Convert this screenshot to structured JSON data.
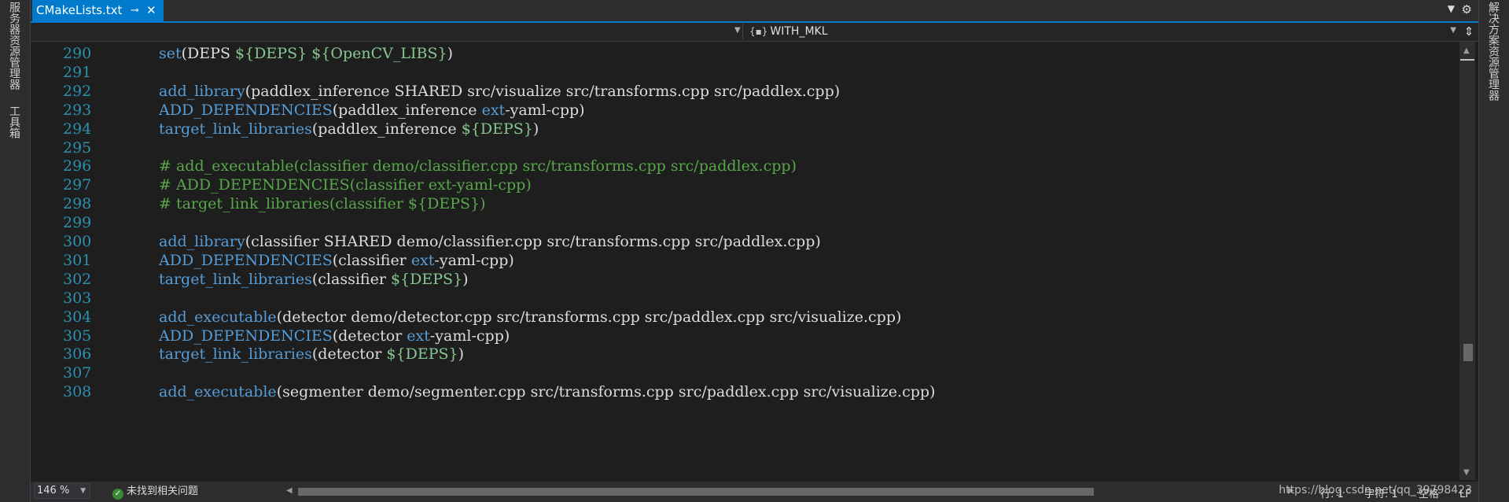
{
  "left_panel": {
    "tabs": [
      "服务器资源管理器",
      "工具箱"
    ]
  },
  "right_panel": {
    "tabs": [
      "解决方案资源管理器"
    ]
  },
  "document_tab": {
    "title": "CMakeLists.txt",
    "pin_icon": "pin-icon",
    "close_icon": "close-icon"
  },
  "navigation": {
    "scope": "WITH_MKL",
    "scope_icon": "macro-icon"
  },
  "code_lines": [
    {
      "n": "290",
      "segments": [
        [
          "fn",
          "set"
        ],
        [
          "p",
          "(DEPS "
        ],
        [
          "var",
          "${DEPS}"
        ],
        [
          "p",
          " "
        ],
        [
          "var",
          "${OpenCV_LIBS}"
        ],
        [
          "p",
          ")"
        ]
      ]
    },
    {
      "n": "291",
      "segments": []
    },
    {
      "n": "292",
      "segments": [
        [
          "fn",
          "add_library"
        ],
        [
          "p",
          "(paddlex_inference SHARED src/visualize src/transforms.cpp src/paddlex.cpp)"
        ]
      ]
    },
    {
      "n": "293",
      "segments": [
        [
          "fn",
          "ADD_DEPENDENCIES"
        ],
        [
          "p",
          "(paddlex_inference "
        ],
        [
          "kw",
          "ext"
        ],
        [
          "p",
          "-yaml-cpp)"
        ]
      ]
    },
    {
      "n": "294",
      "segments": [
        [
          "fn",
          "target_link_libraries"
        ],
        [
          "p",
          "(paddlex_inference "
        ],
        [
          "var",
          "${DEPS}"
        ],
        [
          "p",
          ")"
        ]
      ]
    },
    {
      "n": "295",
      "segments": []
    },
    {
      "n": "296",
      "segments": [
        [
          "cm",
          "# add_executable(classifier demo/classifier.cpp src/transforms.cpp src/paddlex.cpp)"
        ]
      ]
    },
    {
      "n": "297",
      "segments": [
        [
          "cm",
          "# ADD_DEPENDENCIES(classifier ext-yaml-cpp)"
        ]
      ]
    },
    {
      "n": "298",
      "segments": [
        [
          "cm",
          "# target_link_libraries(classifier ${DEPS})"
        ]
      ]
    },
    {
      "n": "299",
      "segments": []
    },
    {
      "n": "300",
      "segments": [
        [
          "fn",
          "add_library"
        ],
        [
          "p",
          "(classifier SHARED demo/classifier.cpp src/transforms.cpp src/paddlex.cpp)"
        ]
      ]
    },
    {
      "n": "301",
      "segments": [
        [
          "fn",
          "ADD_DEPENDENCIES"
        ],
        [
          "p",
          "(classifier "
        ],
        [
          "kw",
          "ext"
        ],
        [
          "p",
          "-yaml-cpp)"
        ]
      ]
    },
    {
      "n": "302",
      "segments": [
        [
          "fn",
          "target_link_libraries"
        ],
        [
          "p",
          "(classifier "
        ],
        [
          "var",
          "${DEPS}"
        ],
        [
          "p",
          ")"
        ]
      ]
    },
    {
      "n": "303",
      "segments": []
    },
    {
      "n": "304",
      "segments": [
        [
          "fn",
          "add_executable"
        ],
        [
          "p",
          "(detector demo/detector.cpp src/transforms.cpp src/paddlex.cpp src/visualize.cpp)"
        ]
      ]
    },
    {
      "n": "305",
      "segments": [
        [
          "fn",
          "ADD_DEPENDENCIES"
        ],
        [
          "p",
          "(detector "
        ],
        [
          "kw",
          "ext"
        ],
        [
          "p",
          "-yaml-cpp)"
        ]
      ]
    },
    {
      "n": "306",
      "segments": [
        [
          "fn",
          "target_link_libraries"
        ],
        [
          "p",
          "(detector "
        ],
        [
          "var",
          "${DEPS}"
        ],
        [
          "p",
          ")"
        ]
      ]
    },
    {
      "n": "307",
      "segments": []
    },
    {
      "n": "308",
      "segments": [
        [
          "fn",
          "add_executable"
        ],
        [
          "p",
          "(segmenter demo/segmenter.cpp src/transforms.cpp src/paddlex.cpp src/visualize.cpp)"
        ]
      ]
    }
  ],
  "status": {
    "zoom": "146 %",
    "issues": "未找到相关问题",
    "line": "行: 1",
    "char": "字符: 1",
    "spaces": "空格",
    "eol": "LF"
  },
  "watermark": "https://blog.csdn.net/qq_39798423",
  "colors": {
    "accent": "#007acc",
    "function": "#569cd6",
    "variable": "#86c691",
    "comment": "#57a64a",
    "line_number": "#2b91af",
    "text": "#dcdcdc"
  }
}
